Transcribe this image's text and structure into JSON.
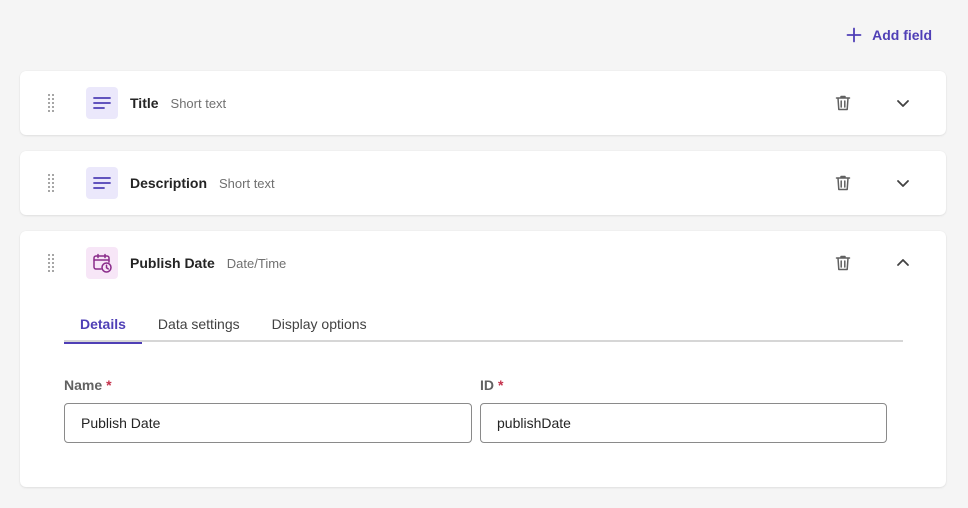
{
  "toolbar": {
    "add_field_label": "Add field"
  },
  "fields": [
    {
      "name": "Title",
      "type": "Short text",
      "icon": "text-lines-icon",
      "expanded": false
    },
    {
      "name": "Description",
      "type": "Short text",
      "icon": "text-lines-icon",
      "expanded": false
    },
    {
      "name": "Publish Date",
      "type": "Date/Time",
      "icon": "calendar-clock-icon",
      "expanded": true
    }
  ],
  "expanded_field": {
    "tabs": [
      {
        "label": "Details",
        "active": true
      },
      {
        "label": "Data settings",
        "active": false
      },
      {
        "label": "Display options",
        "active": false
      }
    ],
    "form": {
      "name_label": "Name",
      "name_value": "Publish Date",
      "id_label": "ID",
      "id_value": "publishDate",
      "required_marker": "*"
    }
  },
  "colors": {
    "accent": "#4f3fb6",
    "required": "#c4314b",
    "text_icon_bg": "#ebe8fb",
    "date_icon_bg": "#f7e6f7",
    "date_icon_fg": "#8a2b8a"
  }
}
